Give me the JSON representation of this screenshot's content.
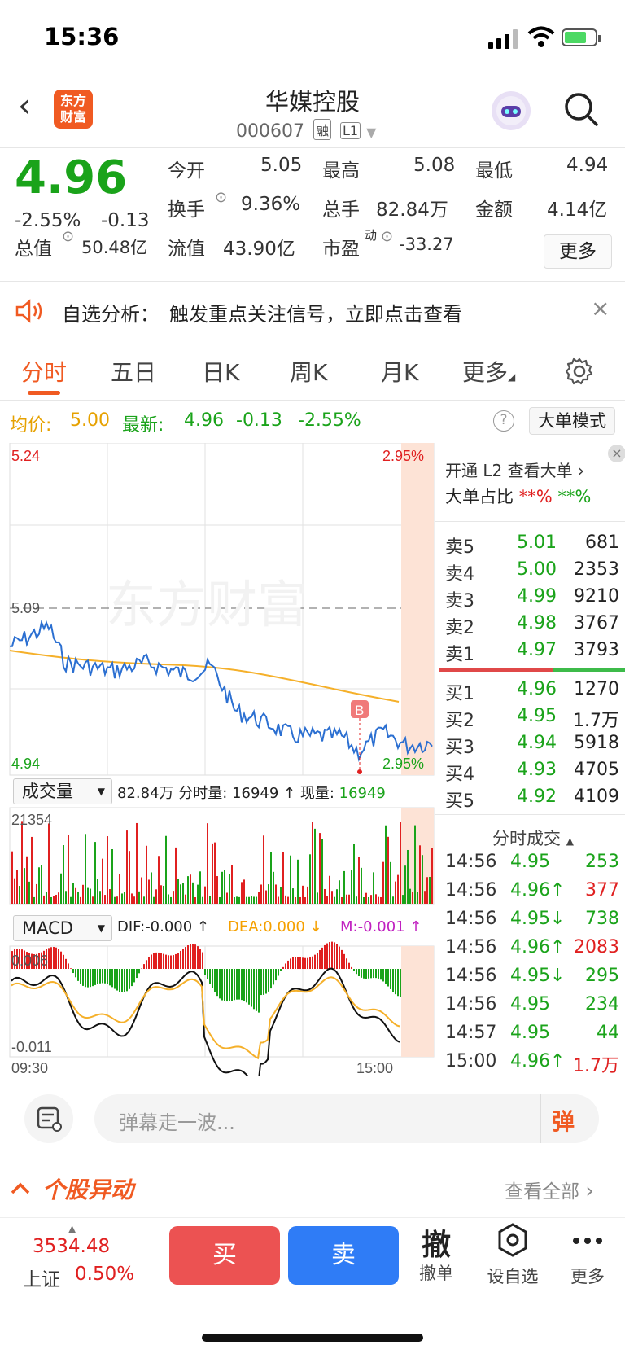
{
  "status": {
    "time": "15:36"
  },
  "header": {
    "title": "华媒控股",
    "code": "000607",
    "tag1": "融",
    "tag2": "L1",
    "logo_line1": "东方",
    "logo_line2": "财富"
  },
  "quote": {
    "price": "4.96",
    "change_pct": "-2.55%",
    "change": "-0.13",
    "open_label": "今开",
    "open": "5.05",
    "high_label": "最高",
    "high": "5.08",
    "low_label": "最低",
    "low": "4.94",
    "turnover_label": "换手",
    "turnover": "9.36%",
    "volume_label": "总手",
    "volume": "82.84万",
    "amount_label": "金额",
    "amount": "4.14亿",
    "mktcap_label": "总值",
    "mktcap": "50.48亿",
    "float_label": "流值",
    "float": "43.90亿",
    "pe_label": "市盈",
    "pe_sup": "动",
    "pe": "-33.27",
    "more": "更多"
  },
  "notice": {
    "label": "自选分析：",
    "text": "触发重点关注信号，立即点击查看"
  },
  "tabs": [
    "分时",
    "五日",
    "日K",
    "周K",
    "月K",
    "更多"
  ],
  "infobar": {
    "avg_label": "均价:",
    "avg": "5.00",
    "latest_label": "最新:",
    "latest": "4.96",
    "chg": "-0.13",
    "pct": "-2.55%",
    "mode": "大单模式"
  },
  "chart": {
    "y_top": "5.24",
    "y_mid": "5.09",
    "y_bottom": "4.94",
    "pct_top": "2.95%",
    "pct_bottom": "2.95%",
    "watermark": "东方财富",
    "vol_selector": "成交量",
    "vol_info": "82.84万 分时量: 16949 ↑ 现量: ",
    "vol_now": "16949",
    "vol_max": "21354",
    "macd_selector": "MACD",
    "dif": "DIF:-0.000 ↑",
    "dea": "DEA:0.000 ↓",
    "m": "M:-0.001 ↑",
    "macd_top": "0.006",
    "macd_bottom": "-0.011",
    "t_start": "09:30",
    "t_end": "15:00",
    "marker": "B"
  },
  "orderbook": {
    "l2": "开通 L2 查看大单",
    "ratio_label": "大单占比",
    "ratio_r": "**%",
    "ratio_g": "**%",
    "sells": [
      {
        "label": "卖5",
        "price": "5.01",
        "vol": "681"
      },
      {
        "label": "卖4",
        "price": "5.00",
        "vol": "2353"
      },
      {
        "label": "卖3",
        "price": "4.99",
        "vol": "9210"
      },
      {
        "label": "卖2",
        "price": "4.98",
        "vol": "3767"
      },
      {
        "label": "卖1",
        "price": "4.97",
        "vol": "3793"
      }
    ],
    "buys": [
      {
        "label": "买1",
        "price": "4.96",
        "vol": "1270"
      },
      {
        "label": "买2",
        "price": "4.95",
        "vol": "1.7万"
      },
      {
        "label": "买3",
        "price": "4.94",
        "vol": "5918"
      },
      {
        "label": "买4",
        "price": "4.93",
        "vol": "4705"
      },
      {
        "label": "买5",
        "price": "4.92",
        "vol": "4109"
      }
    ],
    "trades_title": "分时成交",
    "trades": [
      {
        "t": "14:56",
        "p": "4.95",
        "arrow": "",
        "v": "253",
        "c": "g"
      },
      {
        "t": "14:56",
        "p": "4.96",
        "arrow": "↑",
        "v": "377",
        "c": "r"
      },
      {
        "t": "14:56",
        "p": "4.95",
        "arrow": "↓",
        "v": "738",
        "c": "g"
      },
      {
        "t": "14:56",
        "p": "4.96",
        "arrow": "↑",
        "v": "2083",
        "c": "r"
      },
      {
        "t": "14:56",
        "p": "4.95",
        "arrow": "↓",
        "v": "295",
        "c": "g"
      },
      {
        "t": "14:56",
        "p": "4.95",
        "arrow": "",
        "v": "234",
        "c": "g"
      },
      {
        "t": "14:57",
        "p": "4.95",
        "arrow": "",
        "v": "44",
        "c": "g"
      },
      {
        "t": "15:00",
        "p": "4.96",
        "arrow": "↑",
        "v": "1.7万",
        "c": "r"
      }
    ]
  },
  "danmu": {
    "placeholder": "弹幕走一波...",
    "btn": "弹"
  },
  "movers": {
    "title": "个股异动",
    "more": "查看全部"
  },
  "bottom": {
    "index_value": "3534.48",
    "index_name": "上证",
    "index_pct": "0.50%",
    "buy": "买",
    "sell": "卖",
    "cancel_icon": "撤",
    "cancel": "撤单",
    "watch": "设自选",
    "more": "更多"
  },
  "colors": {
    "up": "#e02020",
    "down": "#1aa31a",
    "accent": "#f05a22",
    "sell_btn": "#2f7cf6",
    "buy_btn": "#ec5252"
  }
}
